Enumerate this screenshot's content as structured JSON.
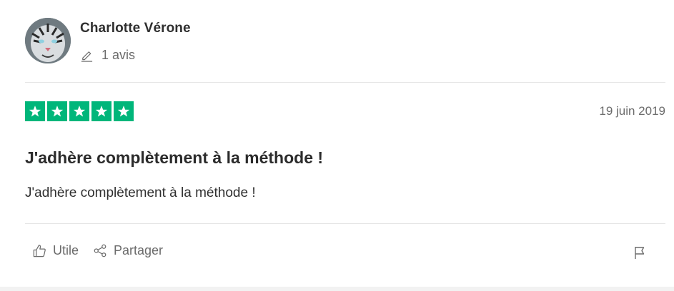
{
  "reviewer": {
    "name": "Charlotte Vérone",
    "review_count": "1 avis"
  },
  "review": {
    "rating": 5,
    "rating_max": 5,
    "date": "19 juin 2019",
    "title": "J'adhère complètement à la méthode !",
    "body": "J'adhère complètement à la méthode !"
  },
  "actions": {
    "useful_label": "Utile",
    "share_label": "Partager"
  },
  "icons": {
    "review_count": "pencil-icon",
    "useful": "thumbs-up-icon",
    "share": "share-icon",
    "report": "flag-icon"
  },
  "colors": {
    "star_background": "#00b67a",
    "text_primary": "#2b2b2b",
    "text_secondary": "#6b6b6b",
    "divider": "#e5e5e5"
  }
}
